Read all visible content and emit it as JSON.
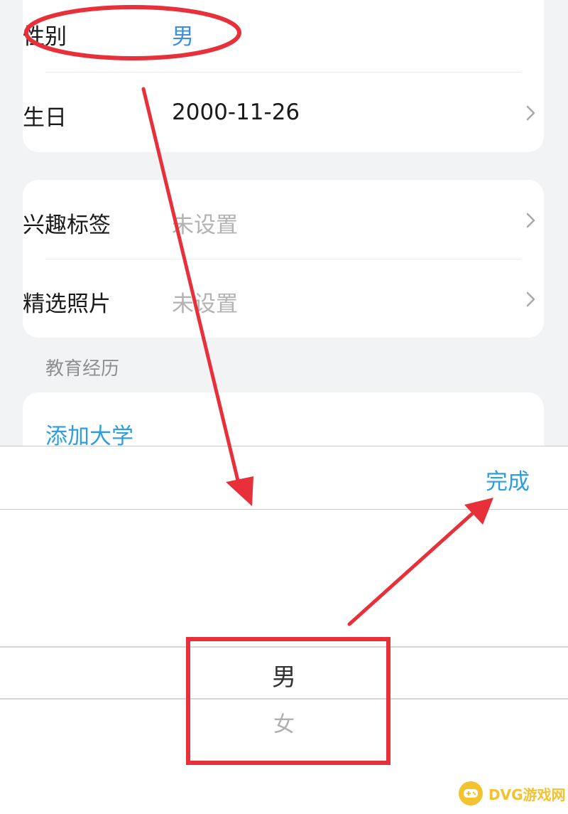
{
  "profile": {
    "gender": {
      "label": "性别",
      "value": "男"
    },
    "birthday": {
      "label": "生日",
      "value": "2000-11-26"
    },
    "interests": {
      "label": "兴趣标签",
      "value": "未设置"
    },
    "photos": {
      "label": "精选照片",
      "value": "未设置"
    }
  },
  "education": {
    "section_title": "教育经历",
    "add_label": "添加大学"
  },
  "picker": {
    "done_label": "完成",
    "options": [
      "男",
      "女"
    ],
    "selected": "男"
  },
  "watermark": {
    "text": "DVG游戏网"
  },
  "colors": {
    "accent": "#2d9fe0",
    "annotation_red": "#e8303a",
    "watermark_yellow": "#f2c230"
  }
}
